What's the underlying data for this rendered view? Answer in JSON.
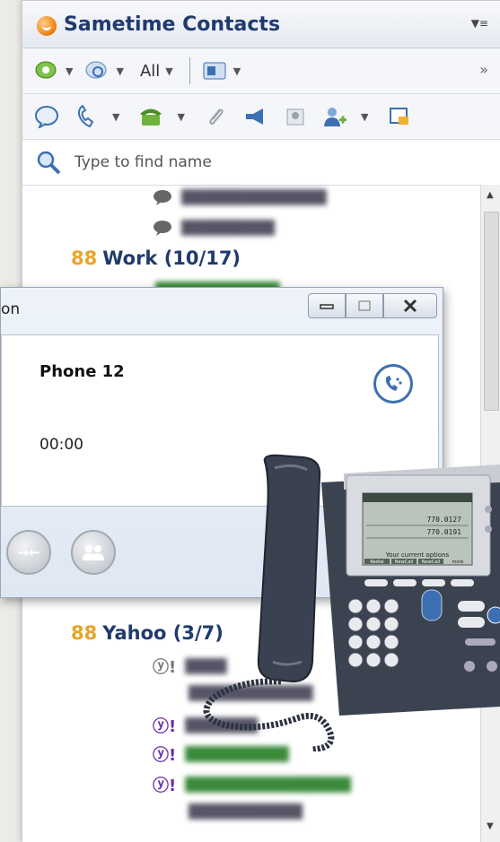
{
  "contacts": {
    "title": "Sametime Contacts",
    "toolbar": {
      "filter_label": "All"
    },
    "search": {
      "placeholder": "Type to find name"
    },
    "groups": [
      {
        "name": "Work (10/17)",
        "count_glyph": "88"
      },
      {
        "name": "Yahoo (3/7)",
        "count_glyph": "88"
      }
    ],
    "yahoo_glyph": "ⓨ!"
  },
  "call_window": {
    "title_fragment": "on",
    "phone_name": "Phone 12",
    "duration": "00:00"
  },
  "desk_phone": {
    "lines": [
      "770.0127",
      "770.0191"
    ],
    "status_text": "Your current options",
    "softkeys": [
      "Redial",
      "NewCall",
      "NewCall",
      "more"
    ]
  },
  "colors": {
    "title_blue": "#1f3b6e",
    "group_count": "#e6a52a",
    "yahoo_purple": "#6b2fa8",
    "call_blue": "#3d6fb3"
  }
}
